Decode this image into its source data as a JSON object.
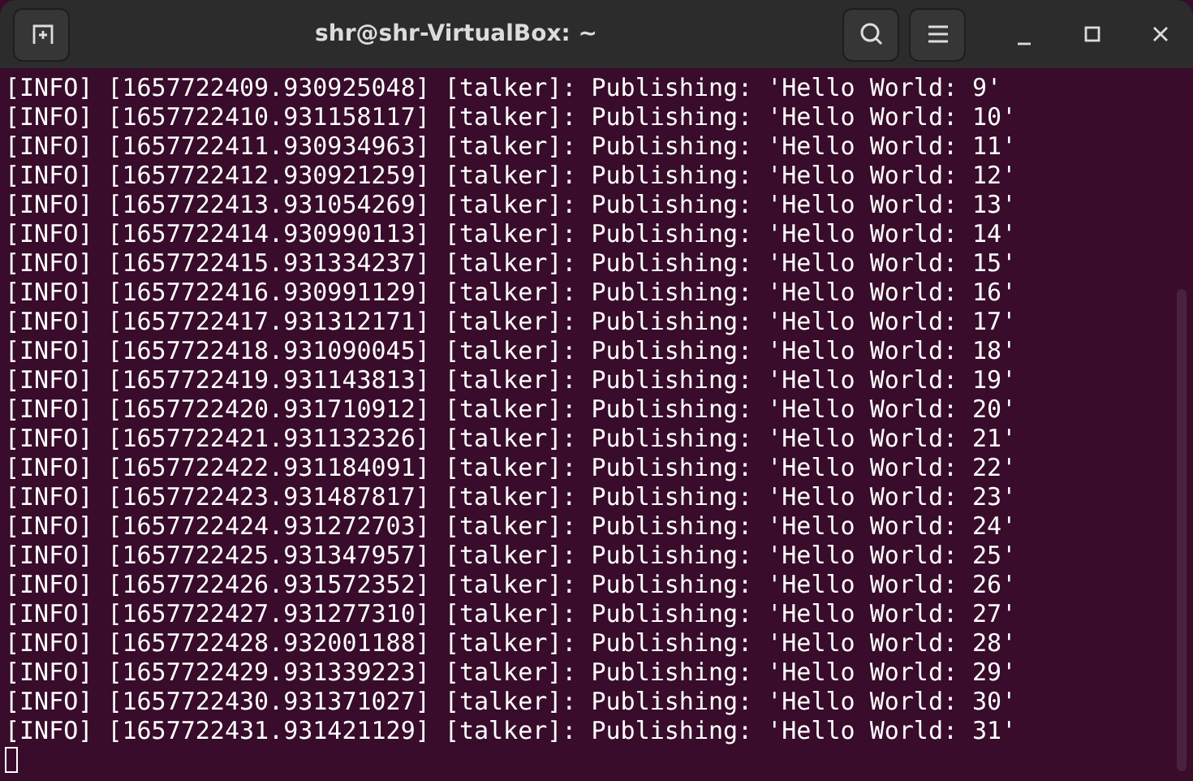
{
  "window": {
    "title": "shr@shr-VirtualBox: ~"
  },
  "terminal": {
    "lines": [
      "[INFO] [1657722409.930925048] [talker]: Publishing: 'Hello World: 9'",
      "[INFO] [1657722410.931158117] [talker]: Publishing: 'Hello World: 10'",
      "[INFO] [1657722411.930934963] [talker]: Publishing: 'Hello World: 11'",
      "[INFO] [1657722412.930921259] [talker]: Publishing: 'Hello World: 12'",
      "[INFO] [1657722413.931054269] [talker]: Publishing: 'Hello World: 13'",
      "[INFO] [1657722414.930990113] [talker]: Publishing: 'Hello World: 14'",
      "[INFO] [1657722415.931334237] [talker]: Publishing: 'Hello World: 15'",
      "[INFO] [1657722416.930991129] [talker]: Publishing: 'Hello World: 16'",
      "[INFO] [1657722417.931312171] [talker]: Publishing: 'Hello World: 17'",
      "[INFO] [1657722418.931090045] [talker]: Publishing: 'Hello World: 18'",
      "[INFO] [1657722419.931143813] [talker]: Publishing: 'Hello World: 19'",
      "[INFO] [1657722420.931710912] [talker]: Publishing: 'Hello World: 20'",
      "[INFO] [1657722421.931132326] [talker]: Publishing: 'Hello World: 21'",
      "[INFO] [1657722422.931184091] [talker]: Publishing: 'Hello World: 22'",
      "[INFO] [1657722423.931487817] [talker]: Publishing: 'Hello World: 23'",
      "[INFO] [1657722424.931272703] [talker]: Publishing: 'Hello World: 24'",
      "[INFO] [1657722425.931347957] [talker]: Publishing: 'Hello World: 25'",
      "[INFO] [1657722426.931572352] [talker]: Publishing: 'Hello World: 26'",
      "[INFO] [1657722427.931277310] [talker]: Publishing: 'Hello World: 27'",
      "[INFO] [1657722428.932001188] [talker]: Publishing: 'Hello World: 28'",
      "[INFO] [1657722429.931339223] [talker]: Publishing: 'Hello World: 29'",
      "[INFO] [1657722430.931371027] [talker]: Publishing: 'Hello World: 30'",
      "[INFO] [1657722431.931421129] [talker]: Publishing: 'Hello World: 31'"
    ]
  }
}
